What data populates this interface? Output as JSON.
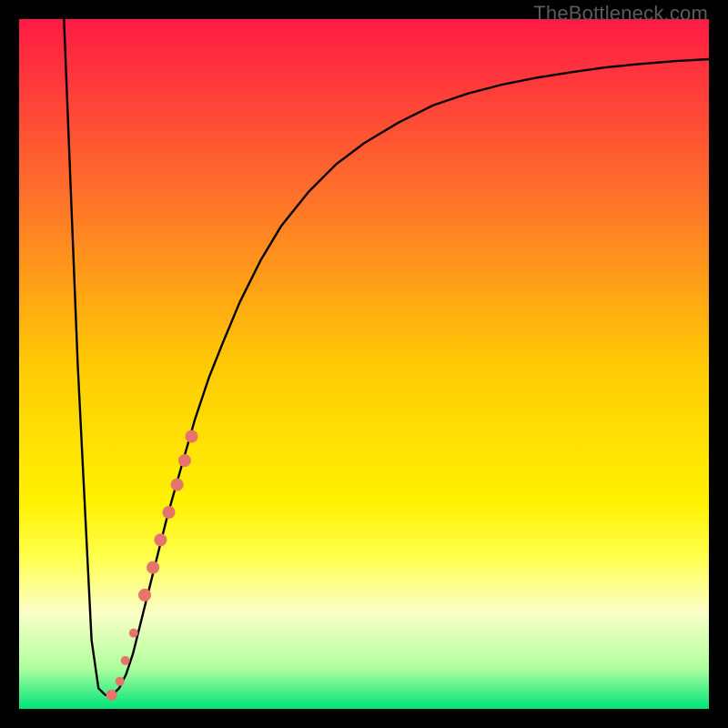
{
  "watermark": "TheBottleneck.com",
  "chart_data": {
    "type": "line",
    "title": "",
    "xlabel": "",
    "ylabel": "",
    "xlim": [
      0,
      100
    ],
    "ylim": [
      0,
      100
    ],
    "background_gradient": {
      "stops": [
        {
          "offset": 0.0,
          "color": "#ff1a44"
        },
        {
          "offset": 0.25,
          "color": "#ff6f2b"
        },
        {
          "offset": 0.5,
          "color": "#ffca05"
        },
        {
          "offset": 0.7,
          "color": "#fff200"
        },
        {
          "offset": 0.78,
          "color": "#ffff4d"
        },
        {
          "offset": 0.86,
          "color": "#fbffc7"
        },
        {
          "offset": 0.94,
          "color": "#b1ff9e"
        },
        {
          "offset": 1.0,
          "color": "#00e47a"
        }
      ]
    },
    "series": [
      {
        "name": "curve",
        "x": [
          6.5,
          8.5,
          10.5,
          11.5,
          12.5,
          13.5,
          14.5,
          15.5,
          16.5,
          17.5,
          19.5,
          21.5,
          23.5,
          25.5,
          27.5,
          29.5,
          32.0,
          35.0,
          38.0,
          42.0,
          46.0,
          50.0,
          55.0,
          60.0,
          65.0,
          70.0,
          75.0,
          80.0,
          85.0,
          90.0,
          95.0,
          100.0
        ],
        "y": [
          100,
          50,
          10,
          3,
          2,
          2,
          3,
          5,
          8,
          12,
          20,
          28,
          35,
          42,
          48,
          53,
          59,
          65,
          70,
          75,
          79,
          82,
          85,
          87.5,
          89.2,
          90.5,
          91.5,
          92.3,
          93.0,
          93.5,
          93.9,
          94.2
        ]
      }
    ],
    "scatter_points": {
      "name": "marker-cluster",
      "color": "#e7746a",
      "points": [
        {
          "x": 13.4,
          "y": 2.0,
          "r": 6
        },
        {
          "x": 14.6,
          "y": 4.0,
          "r": 5
        },
        {
          "x": 15.4,
          "y": 7.0,
          "r": 5
        },
        {
          "x": 16.6,
          "y": 11.0,
          "r": 5
        },
        {
          "x": 18.2,
          "y": 16.5,
          "r": 7
        },
        {
          "x": 19.4,
          "y": 20.5,
          "r": 7
        },
        {
          "x": 20.5,
          "y": 24.5,
          "r": 7
        },
        {
          "x": 21.7,
          "y": 28.5,
          "r": 7
        },
        {
          "x": 22.9,
          "y": 32.5,
          "r": 7
        },
        {
          "x": 24.0,
          "y": 36.0,
          "r": 7
        },
        {
          "x": 25.0,
          "y": 39.5,
          "r": 7
        }
      ]
    }
  }
}
